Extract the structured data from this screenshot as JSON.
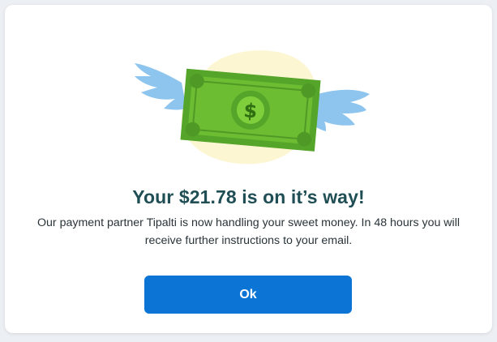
{
  "dialog": {
    "title": "Your $21.78 is on it’s way!",
    "message": "Our payment partner Tipalti is now handling your sweet money. In 48 hours you will receive further instructions to your email.",
    "ok_label": "Ok",
    "illustration_icon": "flying-money-icon"
  },
  "colors": {
    "title": "#1f4e55",
    "button": "#0b74d4",
    "bill_green": "#6dbd32",
    "wing_blue": "#8ec5ee",
    "blob_yellow": "#fdf6d2"
  }
}
